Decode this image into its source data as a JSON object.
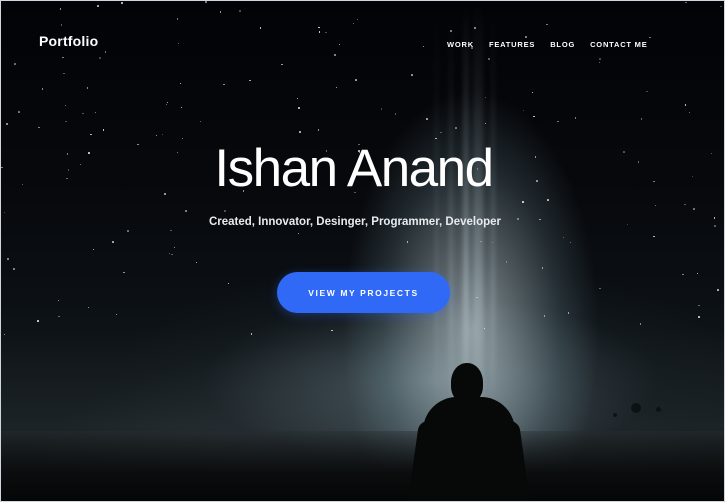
{
  "brand": {
    "logo_text": "Portfolio"
  },
  "nav": {
    "items": [
      {
        "label": "WORK"
      },
      {
        "label": "FEATURES"
      },
      {
        "label": "BLOG"
      },
      {
        "label": "CONTACT ME"
      }
    ]
  },
  "hero": {
    "title": "Ishan Anand",
    "subtitle": "Created, Innovator, Desinger, Programmer, Developer",
    "cta_label": "VIEW MY PROJECTS",
    "background_image": "night-sky-with-light-beam-and-silhouette",
    "accent_color": "#3069f5"
  }
}
